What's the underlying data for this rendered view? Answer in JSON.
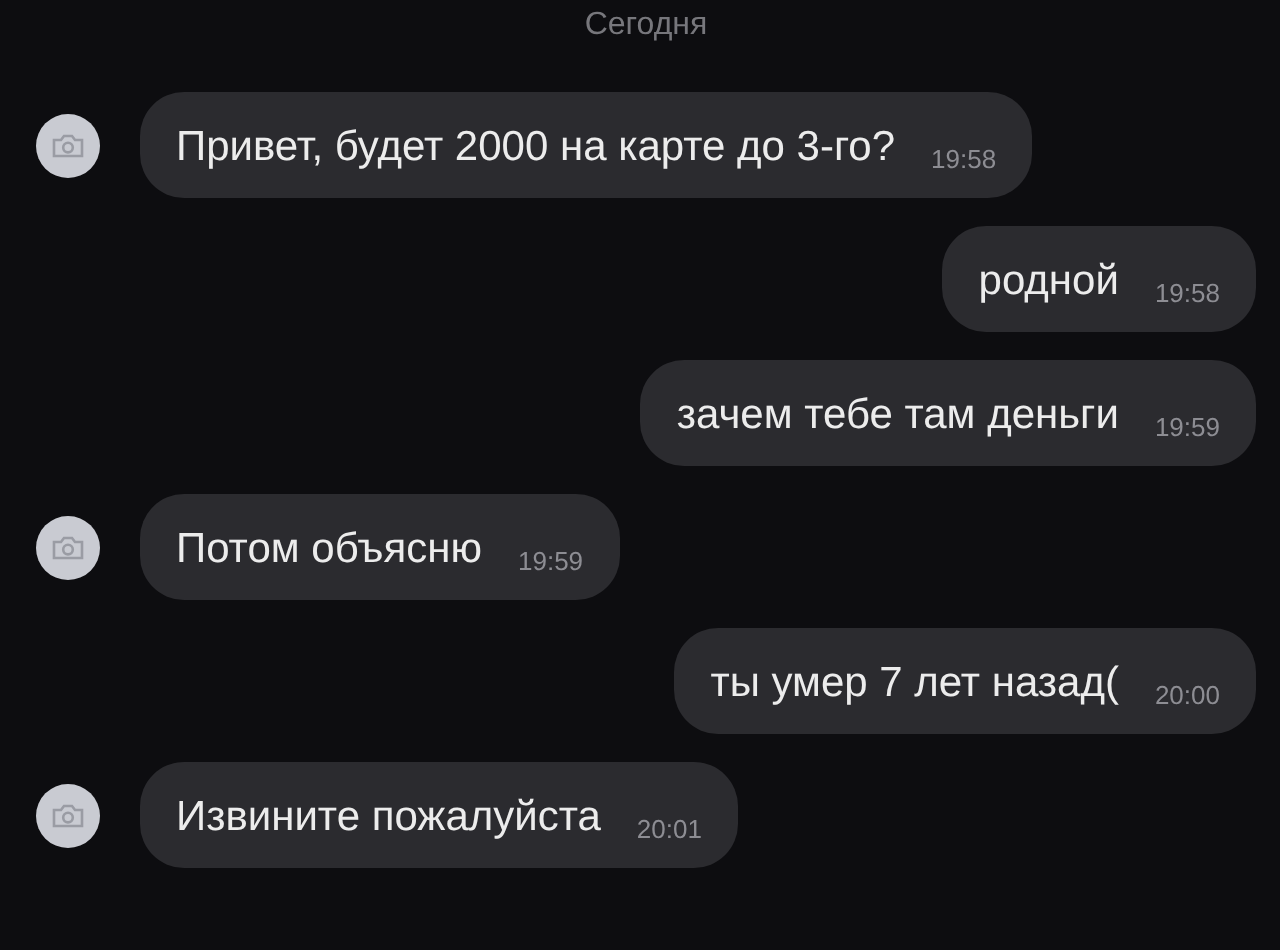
{
  "date_separator": "Сегодня",
  "messages": [
    {
      "kind": "incoming",
      "text": "Привет, будет 2000 на карте до 3-го?",
      "time": "19:58"
    },
    {
      "kind": "outgoing",
      "text": "родной",
      "time": "19:58"
    },
    {
      "kind": "outgoing",
      "text": "зачем тебе там деньги",
      "time": "19:59"
    },
    {
      "kind": "incoming",
      "text": "Потом объясню",
      "time": "19:59"
    },
    {
      "kind": "outgoing",
      "text": "ты умер 7 лет назад(",
      "time": "20:00"
    },
    {
      "kind": "incoming",
      "text": "Извините пожалуйста",
      "time": "20:01"
    }
  ]
}
